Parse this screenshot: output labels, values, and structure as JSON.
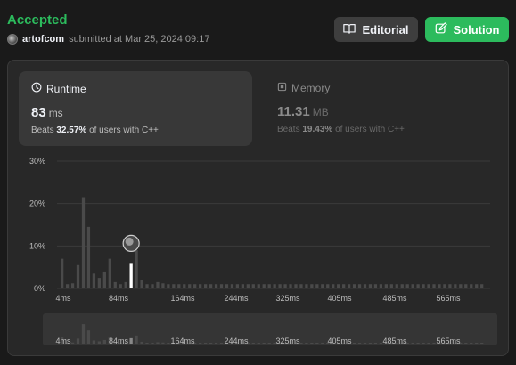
{
  "header": {
    "status": "Accepted",
    "username": "artofcom",
    "submitted_text": "submitted at Mar 25, 2024 09:17",
    "editorial_label": "Editorial",
    "solution_label": "Solution"
  },
  "metrics": {
    "runtime": {
      "title": "Runtime",
      "value": "83",
      "unit": "ms",
      "beats_prefix": "Beats",
      "beats_pct": "32.57%",
      "beats_suffix": "of users with C++"
    },
    "memory": {
      "title": "Memory",
      "value": "11.31",
      "unit": "MB",
      "beats_prefix": "Beats",
      "beats_pct": "19.43%",
      "beats_suffix": "of users with C++"
    }
  },
  "colors": {
    "accent": "#2cbb5d",
    "bar": "#4a4a4a",
    "bar_selected": "#ffffff",
    "panel": "#282828"
  },
  "chart_data": {
    "type": "bar",
    "xlabel": "",
    "ylabel": "",
    "y_ticks": [
      "30%",
      "20%",
      "10%",
      "0%"
    ],
    "ylim": [
      0,
      30
    ],
    "x_tick_labels": [
      "4ms",
      "84ms",
      "164ms",
      "244ms",
      "325ms",
      "405ms",
      "485ms",
      "565ms"
    ],
    "selected_index": 13,
    "values": [
      7,
      1,
      1.2,
      5.5,
      21.5,
      14.5,
      3.5,
      2.5,
      4,
      7,
      1.5,
      1,
      1.5,
      6,
      9,
      2,
      1,
      1,
      1.5,
      1.2,
      1,
      1,
      1,
      1,
      1,
      1,
      1,
      1,
      1,
      1,
      1,
      1,
      1,
      1,
      1,
      1,
      1,
      1,
      1,
      1,
      1,
      1,
      1,
      1,
      1,
      1,
      1,
      1,
      1,
      1,
      1,
      1,
      1,
      1,
      1,
      1,
      1,
      1,
      1,
      1,
      1,
      1,
      1,
      1,
      1,
      1,
      1,
      1,
      1,
      1,
      1,
      1,
      1,
      1,
      1,
      1,
      1,
      1,
      1,
      1
    ],
    "grid": true
  }
}
